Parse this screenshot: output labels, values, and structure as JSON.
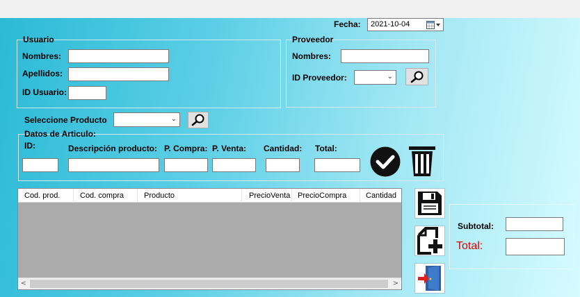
{
  "header": {
    "fecha_label": "Fecha:",
    "fecha_value": "2021-10-04"
  },
  "usuario": {
    "group_title": "Usuario",
    "nombres_label": "Nombres:",
    "apellidos_label": "Apellidos:",
    "id_label": "ID Usuario:",
    "nombres_value": "",
    "apellidos_value": "",
    "id_value": ""
  },
  "proveedor": {
    "group_title": "Proveedor",
    "nombres_label": "Nombres:",
    "id_label": "ID Proveedor:",
    "nombres_value": "",
    "id_selected": ""
  },
  "producto": {
    "select_label": "Seleccione Producto",
    "selected": ""
  },
  "articulo": {
    "group_title": "Datos de Articulo:",
    "id_label": "ID:",
    "descripcion_label": "Descripción producto:",
    "pcompra_label": "P. Compra:",
    "pventa_label": "P. Venta:",
    "cantidad_label": "Cantidad:",
    "total_label": "Total:"
  },
  "grid": {
    "columns": [
      "Cod. prod.",
      "Cod. compra",
      "Producto",
      "PrecioVenta",
      "PrecioCompra",
      "Cantidad"
    ],
    "scroll_left": "<",
    "scroll_right": ">"
  },
  "totals": {
    "subtotal_label": "Subtotal:",
    "total_label": "Total:",
    "subtotal_value": "",
    "total_value": ""
  },
  "colors": {
    "total_red": "#e00000"
  }
}
